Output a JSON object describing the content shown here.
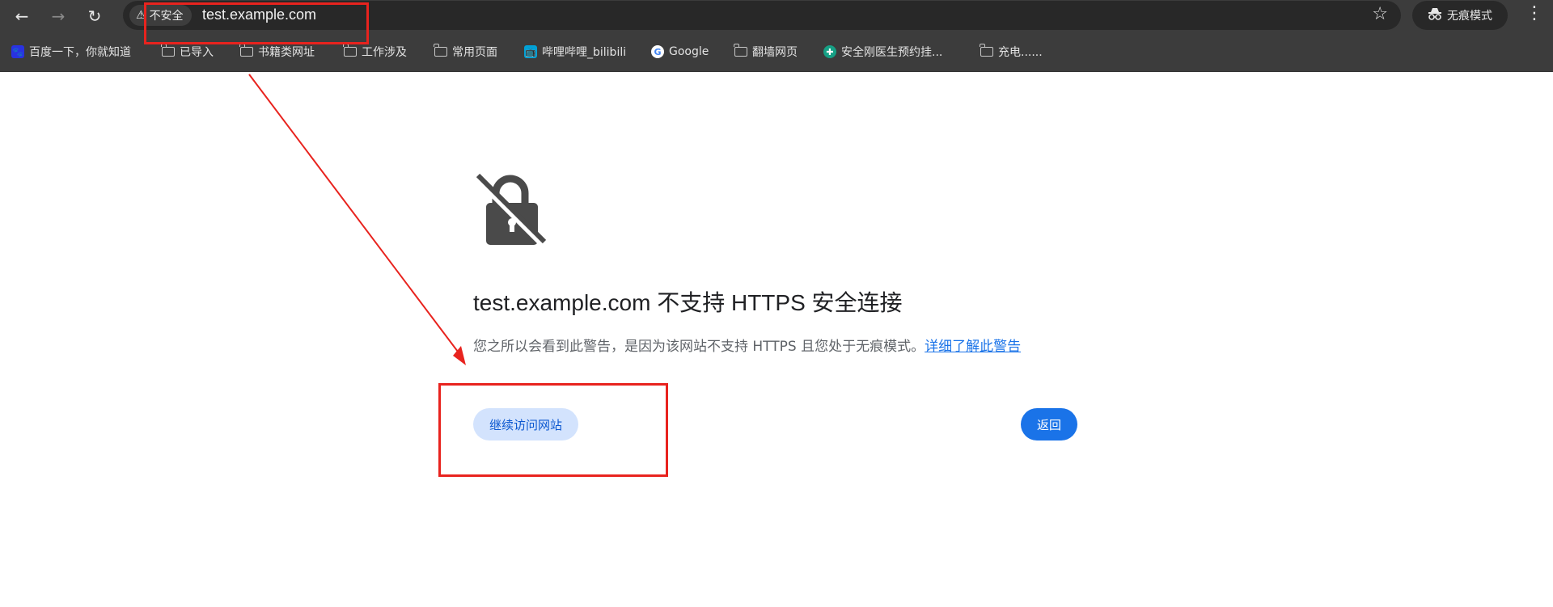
{
  "toolbar": {
    "back_icon": "arrow-left-icon",
    "forward_icon": "arrow-right-icon",
    "reload_icon": "reload-icon",
    "security_chip_label": "不安全",
    "url": "test.example.com",
    "bookmark_star_icon": "star-icon",
    "incognito_label": "无痕模式",
    "menu_icon": "kebab-menu-icon"
  },
  "bookmarks": [
    {
      "label": "百度一下，你就知道",
      "icon": "baidu-icon"
    },
    {
      "label": "已导入",
      "icon": "folder-icon"
    },
    {
      "label": "书籍类网址",
      "icon": "folder-icon"
    },
    {
      "label": "工作涉及",
      "icon": "folder-icon"
    },
    {
      "label": "常用页面",
      "icon": "folder-icon"
    },
    {
      "label": "哔哩哔哩_bilibili",
      "icon": "bilibili-icon"
    },
    {
      "label": "Google",
      "icon": "google-icon"
    },
    {
      "label": "翻墙网页",
      "icon": "folder-icon"
    },
    {
      "label": "安全刚医生预约挂...",
      "icon": "health-icon"
    },
    {
      "label": "充电......",
      "icon": "folder-icon"
    }
  ],
  "interstitial": {
    "icon": "lock-crossed-icon",
    "heading": "test.example.com 不支持 HTTPS 安全连接",
    "description": "您之所以会看到此警告，是因为该网站不支持 HTTPS 且您处于无痕模式。",
    "learn_more_link": "详细了解此警告",
    "proceed_button": "继续访问网站",
    "back_button": "返回"
  },
  "colors": {
    "toolbar_bg": "#3c3c3c",
    "omnibox_bg": "#282828",
    "primary_blue": "#1a73e8",
    "proceed_bg": "#d3e3fd",
    "annotation_red": "#e8231e"
  }
}
